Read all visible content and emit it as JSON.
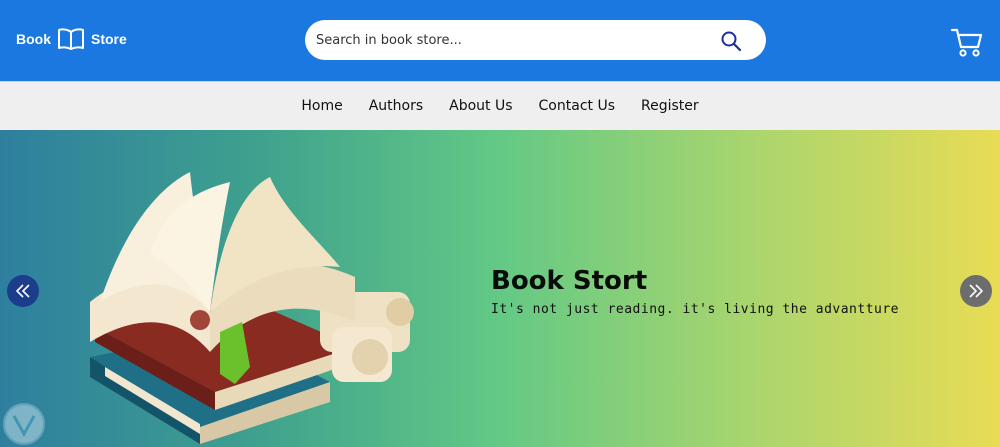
{
  "header": {
    "logo_left": "Book",
    "logo_right": "Store",
    "search": {
      "placeholder": "Search in book store..."
    }
  },
  "nav": {
    "items": [
      {
        "label": "Home"
      },
      {
        "label": "Authors"
      },
      {
        "label": "About Us"
      },
      {
        "label": "Contact Us"
      },
      {
        "label": "Register"
      }
    ]
  },
  "hero": {
    "title": "Book Stort",
    "subtitle": "It's not just reading. it's living the advantture"
  },
  "colors": {
    "header_bg": "#1a78e0",
    "nav_bg": "#efefef",
    "arrow_left_bg": "#1c3d8c",
    "arrow_right_bg": "#6d6d6d"
  },
  "icons": [
    "open-book-icon",
    "search-icon",
    "cart-icon",
    "chevron-left-icon",
    "chevron-right-icon"
  ]
}
